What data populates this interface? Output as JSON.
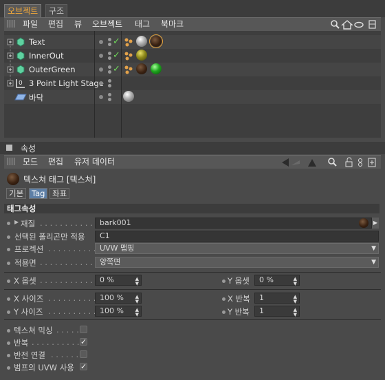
{
  "tabs": [
    {
      "label": "오브젝트"
    },
    {
      "label": "구조"
    }
  ],
  "menu": {
    "items": [
      "파일",
      "편집",
      "뷰",
      "오브젝트",
      "태그",
      "북마크"
    ]
  },
  "objects": [
    {
      "name": "Text",
      "tags": [
        "bark",
        "silver",
        "bark"
      ]
    },
    {
      "name": "InnerOut",
      "tags": [
        "olive"
      ]
    },
    {
      "name": "OuterGreen",
      "tags": [
        "bark",
        "green"
      ]
    },
    {
      "name": "3 Point Light Stage",
      "tags": []
    },
    {
      "name": "바닥",
      "tags": [
        "silver"
      ]
    }
  ],
  "attr": {
    "title": "속성",
    "menu": [
      "모드",
      "편집",
      "유저 데이터"
    ],
    "header": "텍스쳐 태그 [텍스쳐]",
    "subtabs": [
      "기본",
      "Tag",
      "좌표"
    ],
    "section": "태그속성",
    "material_label": "재질",
    "material_value": "bark001",
    "selection_label": "선택된 폴리곤만 적용",
    "selection_value": "C1",
    "projection_label": "프로젝션",
    "projection_value": "UVW 맵핑",
    "side_label": "적용면",
    "side_value": "양쪽면",
    "xoffset_label": "X 옵셋",
    "xoffset_value": "0 %",
    "yoffset_label": "Y 옵셋",
    "yoffset_value": "0 %",
    "xsize_label": "X 사이즈",
    "xsize_value": "100 %",
    "xrepeat_label": "X 반복",
    "xrepeat_value": "1",
    "ysize_label": "Y 사이즈",
    "ysize_value": "100 %",
    "yrepeat_label": "Y 반복",
    "yrepeat_value": "1",
    "mix_label": "텍스쳐 믹싱",
    "mix_checked": false,
    "tile_label": "반복",
    "tile_checked": true,
    "seamless_label": "반전 연결",
    "seamless_checked": false,
    "bump_label": "범프의 UVW 사용",
    "bump_checked": true
  },
  "colors": {
    "accent": "#f2a93b",
    "check": "#6fd65a"
  }
}
